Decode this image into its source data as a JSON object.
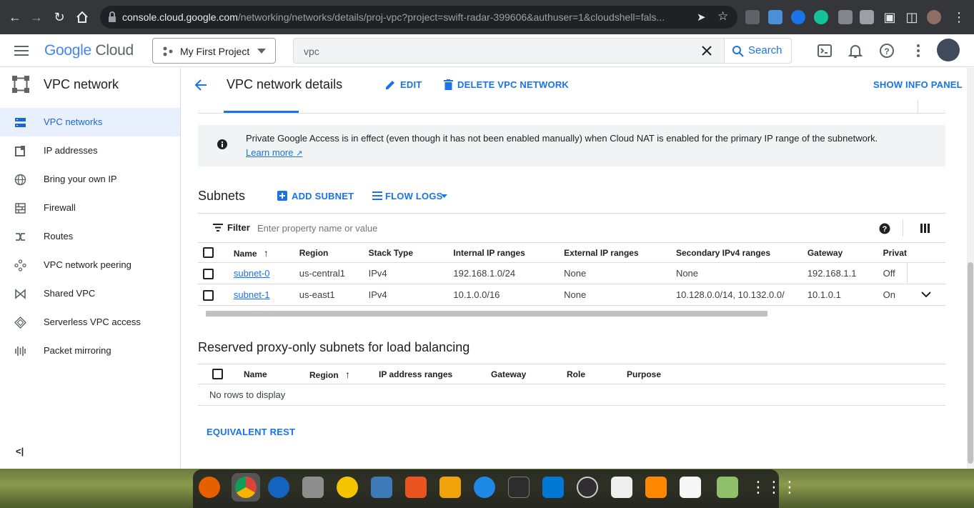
{
  "browser": {
    "url_host": "console.cloud.google.com",
    "url_path": "/networking/networks/details/proj-vpc?project=swift-radar-399606&authuser=1&cloudshell=fals..."
  },
  "header": {
    "logo_google": "Google",
    "logo_cloud": "Cloud",
    "project": "My First Project",
    "search_value": "vpc",
    "search_button": "Search"
  },
  "sidebar": {
    "title": "VPC network",
    "items": [
      {
        "label": "VPC networks",
        "icon": "vpc-networks-icon",
        "active": true
      },
      {
        "label": "IP addresses",
        "icon": "ip-addresses-icon"
      },
      {
        "label": "Bring your own IP",
        "icon": "globe-icon"
      },
      {
        "label": "Firewall",
        "icon": "firewall-icon"
      },
      {
        "label": "Routes",
        "icon": "routes-icon"
      },
      {
        "label": "VPC network peering",
        "icon": "peering-icon"
      },
      {
        "label": "Shared VPC",
        "icon": "shared-vpc-icon"
      },
      {
        "label": "Serverless VPC access",
        "icon": "serverless-icon"
      },
      {
        "label": "Packet mirroring",
        "icon": "packet-mirroring-icon"
      }
    ],
    "collapse_label": "<|"
  },
  "page": {
    "title": "VPC network details",
    "edit": "EDIT",
    "delete": "DELETE VPC NETWORK",
    "info_panel": "SHOW INFO PANEL"
  },
  "banner": {
    "text": "Private Google Access is in effect (even though it has not been enabled manually) when Cloud NAT is enabled for the primary IP range of the subnetwork.",
    "link": "Learn more"
  },
  "subnets": {
    "title": "Subnets",
    "add": "ADD SUBNET",
    "flow_logs": "FLOW LOGS",
    "filter_label": "Filter",
    "filter_placeholder": "Enter property name or value",
    "columns": [
      "Name",
      "Region",
      "Stack Type",
      "Internal IP ranges",
      "External IP ranges",
      "Secondary IPv4 ranges",
      "Gateway",
      "Privat"
    ],
    "rows": [
      {
        "name": "subnet-0",
        "region": "us-central1",
        "stack": "IPv4",
        "internal": "192.168.1.0/24",
        "external": "None",
        "secondary": "None",
        "gateway": "192.168.1.1",
        "private": "Off"
      },
      {
        "name": "subnet-1",
        "region": "us-east1",
        "stack": "IPv4",
        "internal": "10.1.0.0/16",
        "external": "None",
        "secondary": "10.128.0.0/14, 10.132.0.0/",
        "gateway": "10.1.0.1",
        "private": "On"
      }
    ]
  },
  "proxy": {
    "title": "Reserved proxy-only subnets for load balancing",
    "columns": [
      "Name",
      "Region",
      "IP address ranges",
      "Gateway",
      "Role",
      "Purpose"
    ],
    "empty": "No rows to display"
  },
  "equivalent_rest": "EQUIVALENT REST",
  "colors": {
    "accent": "#1a73e8",
    "active_bg": "#e8f0fe",
    "chrome_bar": "#35363a"
  }
}
